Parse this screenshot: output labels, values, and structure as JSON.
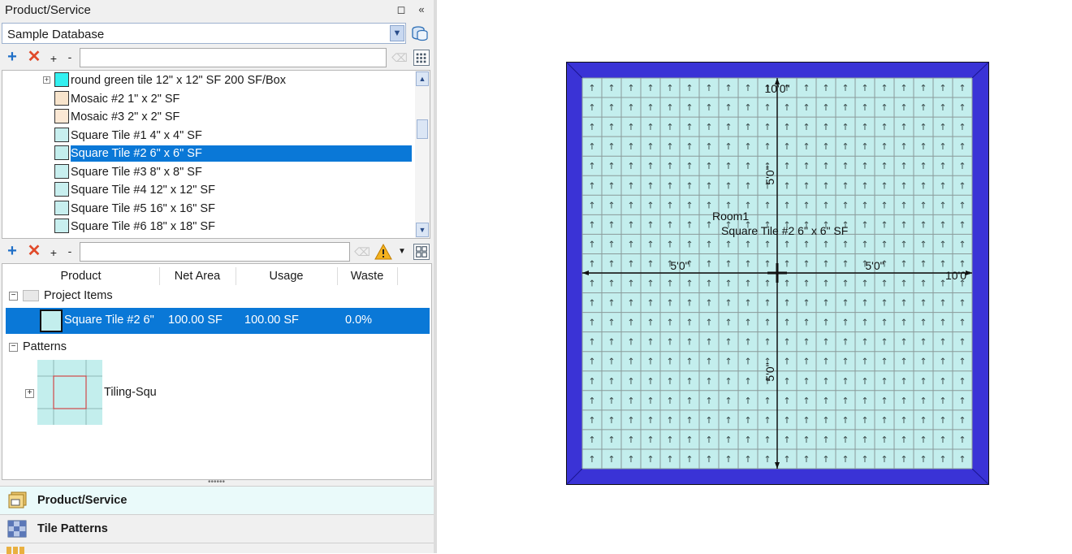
{
  "panel": {
    "title": "Product/Service",
    "pin_glyph": "◻",
    "collapse_glyph": "«"
  },
  "database": {
    "selected": "Sample Database"
  },
  "toolbar": {
    "add_glyph": "+",
    "delete_glyph": "✕",
    "small_plus": "+",
    "small_minus": "-",
    "search_value": "",
    "clear_glyph": "⌫"
  },
  "tree": {
    "items": [
      {
        "label": "round green tile 12\" x 12\" SF 200 SF/Box",
        "swatch": "#33f0f0",
        "expander": "+"
      },
      {
        "label": "Mosaic #2 1\" x 2\" SF",
        "swatch": "#f8e4cc"
      },
      {
        "label": "Mosaic #3 2\" x 2\" SF",
        "swatch": "#fbe8d4"
      },
      {
        "label": "Square Tile #1 4\" x 4\" SF",
        "swatch": "#c8efef"
      },
      {
        "label": "Square Tile #2 6\" x 6\" SF",
        "swatch": "#c3eeed",
        "selected": true
      },
      {
        "label": "Square Tile #3 8\" x 8\" SF",
        "swatch": "#c8efef"
      },
      {
        "label": "Square Tile #4 12\" x 12\" SF",
        "swatch": "#c8efef"
      },
      {
        "label": "Square Tile #5 16\" x 16\" SF",
        "swatch": "#c8efef"
      },
      {
        "label": "Square Tile #6 18\" x 18\" SF",
        "swatch": "#c8efef"
      }
    ]
  },
  "project": {
    "columns": [
      "Product",
      "Net Area",
      "Usage",
      "Waste"
    ],
    "group_items": "Project Items",
    "item": {
      "product": "Square Tile #2 6\"",
      "net_area": "100.00 SF",
      "usage": "100.00 SF",
      "waste": "0.0%"
    },
    "group_patterns": "Patterns",
    "pattern_label": "Tiling-Squ"
  },
  "nav": {
    "items": [
      {
        "label": "Product/Service",
        "active": true
      },
      {
        "label": "Tile Patterns",
        "active": false
      }
    ]
  },
  "drawing": {
    "room_name": "Room1",
    "product_label": "Square Tile #2 6\" x 6\" SF",
    "dim_full_top": "10'0\"",
    "dim_full_right": "10'0\"",
    "dim_half_left": "5'0\"",
    "dim_half_right": "5'0\"",
    "dim_half_top": "5'0\"",
    "dim_half_bottom": "5'0\"",
    "border_color": "#3a33d6",
    "tile_color": "#c3eeed",
    "grout_color": "#8a9a9a",
    "grid_tiles": 20,
    "arrow_glyph": "↑"
  }
}
